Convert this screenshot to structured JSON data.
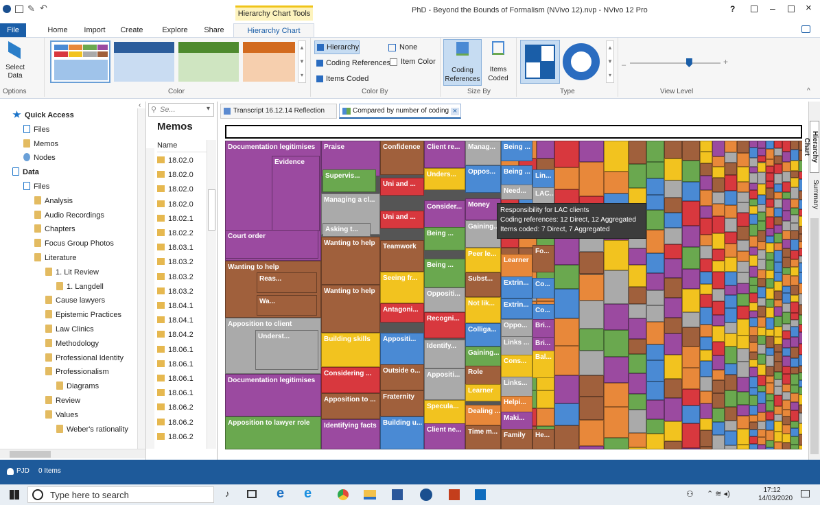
{
  "window": {
    "title": "PhD - Beyond the Bounds of Formalism (NVivo 12).nvp - NVivo 12 Pro",
    "context_tool": "Hierarchy Chart Tools",
    "help": "?",
    "min": "–",
    "close": "×"
  },
  "tabs": [
    "File",
    "Home",
    "Import",
    "Create",
    "Explore",
    "Share",
    "Hierarchy Chart"
  ],
  "ribbon": {
    "select_data": "Select Data",
    "options_label": "Options",
    "color_label": "Color",
    "colorby_label": "Color By",
    "sizeby_label": "Size By",
    "type_label": "Type",
    "viewlevel_label": "View Level",
    "opt_hierarchy": "Hierarchy",
    "opt_coding_refs": "Coding References",
    "opt_items_coded": "Items Coded",
    "opt_none": "None",
    "opt_item_color": "Item Color",
    "size_coding_refs": "Coding References",
    "size_items_coded": "Items Coded",
    "view_level": 0.65
  },
  "nav": {
    "items": [
      {
        "label": "Quick Access",
        "bold": true,
        "indent": 0,
        "icon": "star-icon"
      },
      {
        "label": "Files",
        "indent": 1,
        "icon": "files-icon"
      },
      {
        "label": "Memos",
        "indent": 1,
        "icon": "memos-icon"
      },
      {
        "label": "Nodes",
        "indent": 1,
        "icon": "nodes-icon"
      },
      {
        "label": "Data",
        "bold": true,
        "indent": 0,
        "icon": "data-icon"
      },
      {
        "label": "Files",
        "indent": 1,
        "icon": "files-icon"
      },
      {
        "label": "Analysis",
        "indent": 2,
        "icon": "folder-icon"
      },
      {
        "label": "Audio Recordings",
        "indent": 2,
        "icon": "folder-icon"
      },
      {
        "label": "Chapters",
        "indent": 2,
        "icon": "folder-icon"
      },
      {
        "label": "Focus Group Photos",
        "indent": 2,
        "icon": "folder-icon"
      },
      {
        "label": "Literature",
        "indent": 2,
        "icon": "folder-icon"
      },
      {
        "label": "1. Lit Review",
        "indent": 3,
        "icon": "folder-icon"
      },
      {
        "label": "1. Langdell",
        "indent": 4,
        "icon": "folder-icon"
      },
      {
        "label": "Cause lawyers",
        "indent": 3,
        "icon": "folder-icon"
      },
      {
        "label": "Epistemic Practices",
        "indent": 3,
        "icon": "folder-icon"
      },
      {
        "label": "Law Clinics",
        "indent": 3,
        "icon": "folder-icon"
      },
      {
        "label": "Methodology",
        "indent": 3,
        "icon": "folder-icon"
      },
      {
        "label": "Professional Identity",
        "indent": 3,
        "icon": "folder-icon"
      },
      {
        "label": "Professionalism",
        "indent": 3,
        "icon": "folder-icon"
      },
      {
        "label": "Diagrams",
        "indent": 4,
        "icon": "folder-icon"
      },
      {
        "label": "Review",
        "indent": 3,
        "icon": "folder-icon"
      },
      {
        "label": "Values",
        "indent": 3,
        "icon": "folder-icon"
      },
      {
        "label": "Weber's rationality",
        "indent": 4,
        "icon": "folder-icon"
      }
    ]
  },
  "memos": {
    "search_placeholder": "Se...",
    "title": "Memos",
    "col_name": "Name",
    "rows": [
      "18.02.0",
      "18.02.0",
      "18.02.0",
      "18.02.0",
      "18.02.1",
      "18.02.2",
      "18.03.1",
      "18.03.2",
      "18.03.2",
      "18.03.2",
      "18.04.1",
      "18.04.1",
      "18.04.2",
      "18.06.1",
      "18.06.1",
      "18.06.1",
      "18.06.1",
      "18.06.2",
      "18.06.2",
      "18.06.2"
    ]
  },
  "doc_tabs": [
    "Transcript 16.12.14 Reflection",
    "Compared by number of coding r"
  ],
  "side_tabs": [
    "Hierarchy Chart",
    "Summary"
  ],
  "tooltip": {
    "title": "Responsibility for LAC clients",
    "line1": "Coding references: 12 Direct, 12 Aggregated",
    "line2": "Items coded: 7 Direct, 7 Aggregated"
  },
  "chart_data": {
    "type": "treemap",
    "colors": [
      "#9b4aa0",
      "#a0603c",
      "#d8383e",
      "#f2c31f",
      "#aaaaaa",
      "#6aa84f",
      "#4a8ad4",
      "#e8883a"
    ],
    "labels": [
      "Documentation legitimises",
      "Evidence",
      "Court order",
      "Wanting to help",
      "Reas...",
      "Wa...",
      "Apposition to client",
      "Underst...",
      "Documentation legitimises",
      "Apposition to lawyer role",
      "Praise",
      "Supervis...",
      "Managing a cl...",
      "Asking t...",
      "Wanting to help",
      "Wanting to help",
      "Building skills",
      "Considering ...",
      "Apposition to ...",
      "Identifying facts",
      "Confidence",
      "Uni and ...",
      "Uni and ...",
      "Teamwork",
      "Seeing fr...",
      "Antagoni...",
      "Appositi...",
      "Outside o...",
      "Fraternity",
      "Building u...",
      "Client re...",
      "Unders...",
      "Consider...",
      "Being ...",
      "Being ...",
      "Oppositi...",
      "Recogni...",
      "Identify...",
      "Appositi...",
      "Specula...",
      "Client ne...",
      "Manag...",
      "Oppos...",
      "Money",
      "Gaining...",
      "Peer le...",
      "Subst...",
      "Not lik...",
      "Colliga...",
      "Gaining...",
      "Role",
      "Learner",
      "Dealing ...",
      "Time m...",
      "Being ...",
      "Being ...",
      "Need...",
      "Learner",
      "Extrin...",
      "Extrin...",
      "Oppo...",
      "Links ...",
      "Cons...",
      "Links...",
      "Helpi...",
      "Maki...",
      "Family",
      "Lin...",
      "LAC...",
      "Fo...",
      "Co...",
      "Co...",
      "Bri...",
      "Bri...",
      "Bal...",
      "He..."
    ]
  },
  "status": {
    "user": "PJD",
    "items": "0 Items"
  },
  "taskbar": {
    "search": "Type here to search",
    "time": "17:12",
    "date": "14/03/2020"
  }
}
